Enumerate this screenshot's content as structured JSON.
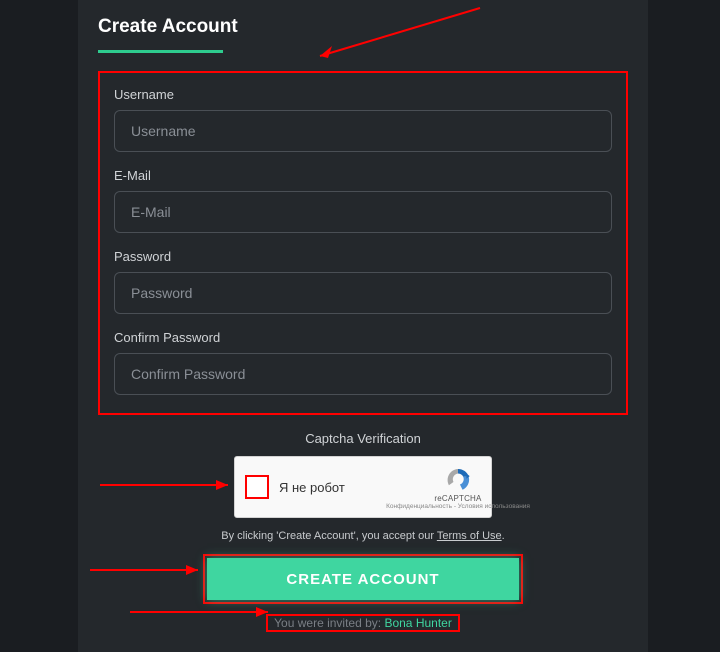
{
  "title": "Create Account",
  "fields": {
    "username": {
      "label": "Username",
      "placeholder": "Username"
    },
    "email": {
      "label": "E-Mail",
      "placeholder": "E-Mail"
    },
    "password": {
      "label": "Password",
      "placeholder": "Password"
    },
    "confirm": {
      "label": "Confirm Password",
      "placeholder": "Confirm Password"
    }
  },
  "captcha": {
    "title": "Captcha Verification",
    "label": "Я не робот",
    "brand": "reCAPTCHA",
    "terms": "Конфиденциальность - Условия использования"
  },
  "tos": {
    "prefix": "By clicking 'Create Account', you accept our ",
    "link": "Terms of Use",
    "suffix": "."
  },
  "submit": "CREATE ACCOUNT",
  "invited": {
    "prefix": "You were invited by: ",
    "name": "Bona Hunter"
  }
}
